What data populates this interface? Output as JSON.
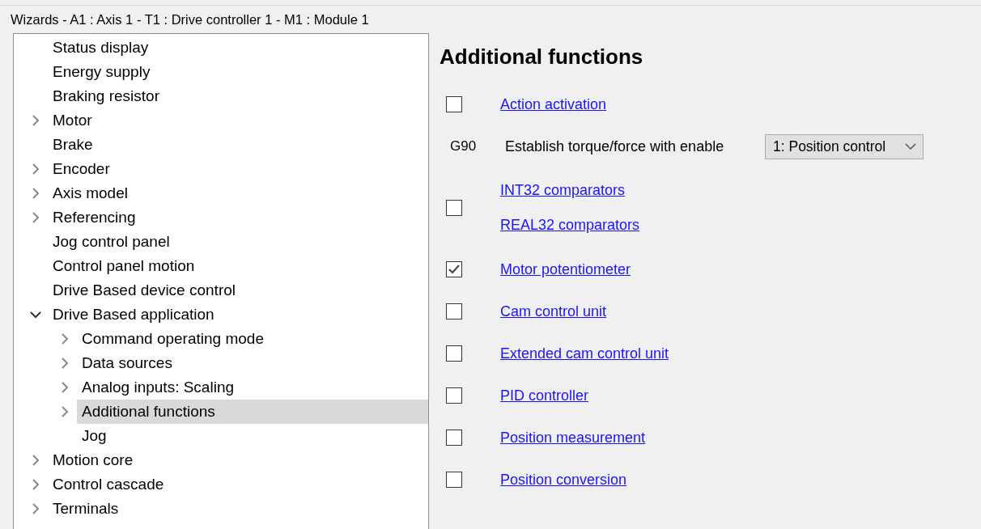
{
  "title": "Wizards - A1 : Axis 1 - T1 : Drive controller 1 - M1 : Module 1",
  "tree": [
    {
      "label": "Status display",
      "selected": false
    },
    {
      "label": "Energy supply",
      "selected": false
    },
    {
      "label": "Braking resistor",
      "selected": false
    },
    {
      "label": "Motor",
      "selected": false,
      "expanded": false
    },
    {
      "label": "Brake",
      "selected": false
    },
    {
      "label": "Encoder",
      "selected": false,
      "expanded": false
    },
    {
      "label": "Axis model",
      "selected": false,
      "expanded": false
    },
    {
      "label": "Referencing",
      "selected": false,
      "expanded": false
    },
    {
      "label": "Jog control panel",
      "selected": false
    },
    {
      "label": "Control panel motion",
      "selected": false
    },
    {
      "label": "Drive Based device control",
      "selected": false
    },
    {
      "label": "Drive Based application",
      "selected": false,
      "expanded": true,
      "children": [
        {
          "label": "Command operating mode",
          "selected": false,
          "expanded": false
        },
        {
          "label": "Data sources",
          "selected": false,
          "expanded": false
        },
        {
          "label": "Analog inputs: Scaling",
          "selected": false,
          "expanded": false
        },
        {
          "label": "Additional functions",
          "selected": true,
          "expanded": false
        },
        {
          "label": "Jog",
          "selected": false
        }
      ]
    },
    {
      "label": "Motion core",
      "selected": false,
      "expanded": false
    },
    {
      "label": "Control cascade",
      "selected": false,
      "expanded": false
    },
    {
      "label": "Terminals",
      "selected": false,
      "expanded": false
    }
  ],
  "heading": "Additional functions",
  "functions": [
    {
      "kind": "check",
      "checked": false,
      "links": [
        "Action activation"
      ]
    },
    {
      "kind": "setting",
      "code": "G90",
      "label": "Establish torque/force with enable",
      "value": "1: Position control"
    },
    {
      "kind": "check",
      "checked": false,
      "links": [
        "INT32 comparators",
        "REAL32 comparators"
      ]
    },
    {
      "kind": "check",
      "checked": true,
      "links": [
        "Motor potentiometer"
      ]
    },
    {
      "kind": "check",
      "checked": false,
      "links": [
        "Cam control unit"
      ]
    },
    {
      "kind": "check",
      "checked": false,
      "links": [
        "Extended cam control unit"
      ]
    },
    {
      "kind": "check",
      "checked": false,
      "links": [
        "PID controller"
      ]
    },
    {
      "kind": "check",
      "checked": false,
      "links": [
        "Position measurement"
      ]
    },
    {
      "kind": "check",
      "checked": false,
      "links": [
        "Position conversion"
      ]
    }
  ]
}
